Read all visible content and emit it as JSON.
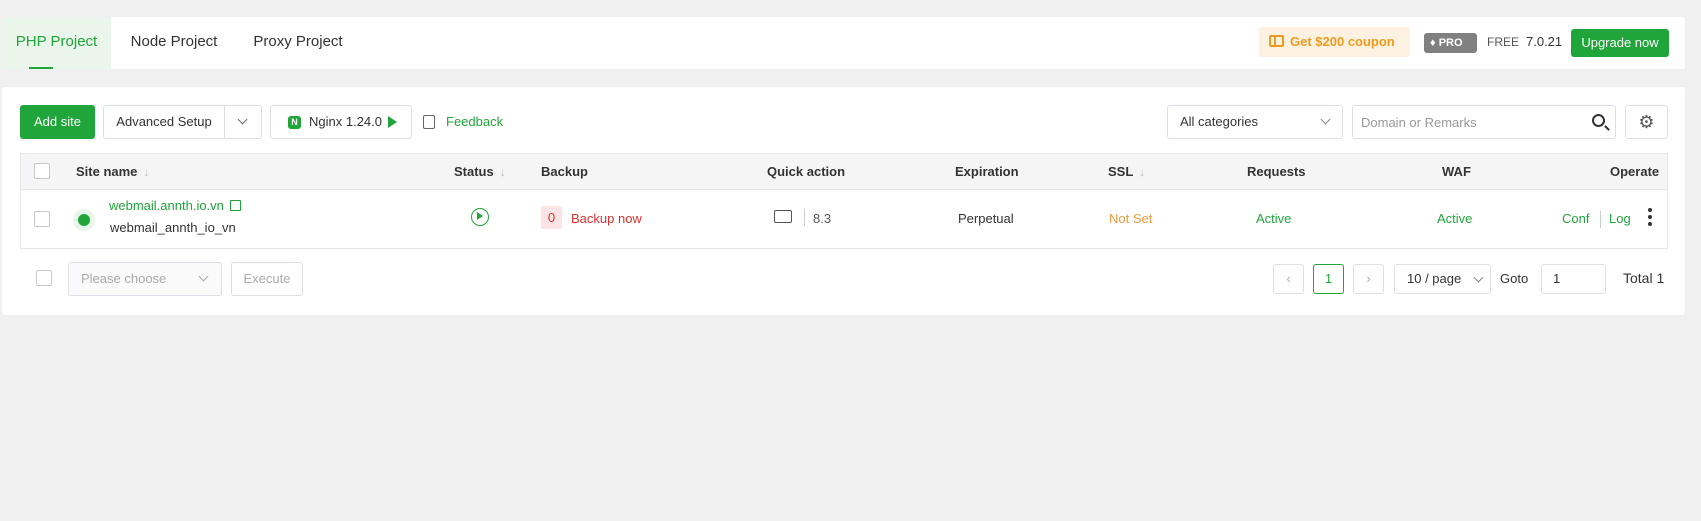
{
  "tabs": [
    {
      "label": "PHP Project",
      "active": true
    },
    {
      "label": "Node Project",
      "active": false
    },
    {
      "label": "Proxy Project",
      "active": false
    }
  ],
  "header": {
    "coupon_label": "Get $200 coupon",
    "pro_badge": "PRO",
    "free_label": "FREE",
    "version": "7.0.21",
    "upgrade_label": "Upgrade now"
  },
  "toolbar": {
    "add_site_label": "Add site",
    "advanced_setup_label": "Advanced Setup",
    "nginx_label": "Nginx 1.24.0",
    "nginx_icon_letter": "N",
    "feedback_label": "Feedback",
    "category_selected": "All categories",
    "search_placeholder": "Domain or Remarks"
  },
  "table": {
    "headers": {
      "site_name": "Site name",
      "status": "Status",
      "backup": "Backup",
      "quick_action": "Quick action",
      "expiration": "Expiration",
      "ssl": "SSL",
      "requests": "Requests",
      "waf": "WAF",
      "operate": "Operate"
    },
    "sort_arrow": "↓",
    "rows": [
      {
        "domain": "webmail.annth.io.vn",
        "remark": "webmail_annth_io_vn",
        "status": "running",
        "backup_count": "0",
        "backup_action": "Backup now",
        "php_version": "8.3",
        "expiration": "Perpetual",
        "ssl": "Not Set",
        "requests": "Active",
        "waf": "Active",
        "conf_label": "Conf",
        "log_label": "Log"
      }
    ]
  },
  "footer": {
    "batch_placeholder": "Please choose",
    "execute_label": "Execute",
    "prev_glyph": "‹",
    "next_glyph": "›",
    "current_page": "1",
    "per_page": "10 / page",
    "goto_label": "Goto",
    "goto_value": "1",
    "total_label": "Total 1"
  },
  "colors": {
    "accent": "#20a53a",
    "danger": "#e0302d",
    "warning": "#f09a3e",
    "coupon": "#f09a1e"
  }
}
